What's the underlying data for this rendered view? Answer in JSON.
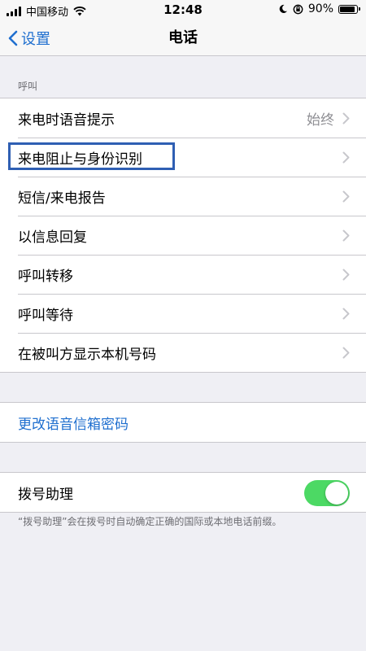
{
  "status_bar": {
    "carrier": "中国移动",
    "time": "12:48",
    "battery_text": "90%",
    "battery_level": 0.9,
    "icons": [
      "signal-icon",
      "wifi-icon",
      "moon-icon",
      "orientation-lock-icon",
      "battery-icon"
    ]
  },
  "nav": {
    "back_label": "设置",
    "title": "电话"
  },
  "calls_section": {
    "header": "呼叫",
    "items": [
      {
        "label": "来电时语音提示",
        "value": "始终"
      },
      {
        "label": "来电阻止与身份识别",
        "value": ""
      },
      {
        "label": "短信/来电报告",
        "value": ""
      },
      {
        "label": "以信息回复",
        "value": ""
      },
      {
        "label": "呼叫转移",
        "value": ""
      },
      {
        "label": "呼叫等待",
        "value": ""
      },
      {
        "label": "在被叫方显示本机号码",
        "value": ""
      }
    ]
  },
  "voicemail": {
    "change_password_label": "更改语音信箱密码"
  },
  "dial_assist": {
    "label": "拨号助理",
    "enabled": true,
    "footer": "“拨号助理”会在拨号时自动确定正确的国际或本地电话前缀。"
  },
  "colors": {
    "accent": "#1f6fcf",
    "toggle_on": "#4cd964",
    "highlight_box": "#2f5fb3",
    "background": "#efeff4"
  }
}
